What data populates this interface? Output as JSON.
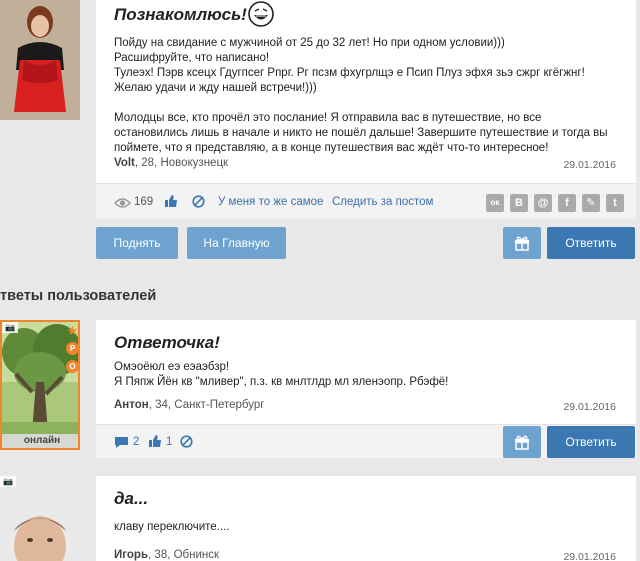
{
  "post": {
    "title": "Познакомлюсь!",
    "body_line1": "Пойду на свидание с мужчиной от 25 до 32 лет! Но при одном условии)))",
    "body_line2": "Расшифруйте, что написано!",
    "body_line3": "Тулеэх! Пэрв ксецх Гдугпсег Рпрг. Рг псзм фхугрлщэ е Псип Плуз эфхя зьэ сжрг кгёгжнг!",
    "body_line4": "Желаю удачи и жду нашей встречи!)))",
    "body_para2_line1": "Молодцы все, кто прочёл это послание! Я отправила вас в путешествие, но все",
    "body_para2_line2": "остановились лишь в начале и никто не пошёл дальше! Завершите путешествие и тогда вы",
    "body_para2_line3": "поймете, что я представляю, а в конце путешествия вас ждёт что-то интересное!",
    "author_name": "Volt",
    "author_info": ", 28, Новокузнецк",
    "date": "29.01.2016",
    "views": "169",
    "same_link": "У меня то же самое",
    "follow_link": "Следить за постом",
    "share": [
      "ок",
      "В",
      "@",
      "f",
      "✎",
      "t"
    ]
  },
  "actions": {
    "raise": "Поднять",
    "home": "На Главную",
    "reply": "Ответить"
  },
  "section_title": "тветы пользователей",
  "reply1": {
    "title": "Ответочка!",
    "line1": "Омэоёюл еэ еэаэбзр!",
    "line2": "Я Пяпж Йён кв \"мливер\", п.з. кв мнлтлдр мл яленэопр. Рбэфё!",
    "author_name": "Антон",
    "author_info": ", 34, Санкт-Петербург",
    "date": "29.01.2016",
    "comments": "2",
    "likes": "1",
    "online": "онлайн",
    "reply": "Ответить"
  },
  "reply2": {
    "title": "да...",
    "line1": "клаву переключите....",
    "author_name": "Игорь",
    "author_info": ", 38, Обнинск",
    "date": "29.01.2016"
  }
}
